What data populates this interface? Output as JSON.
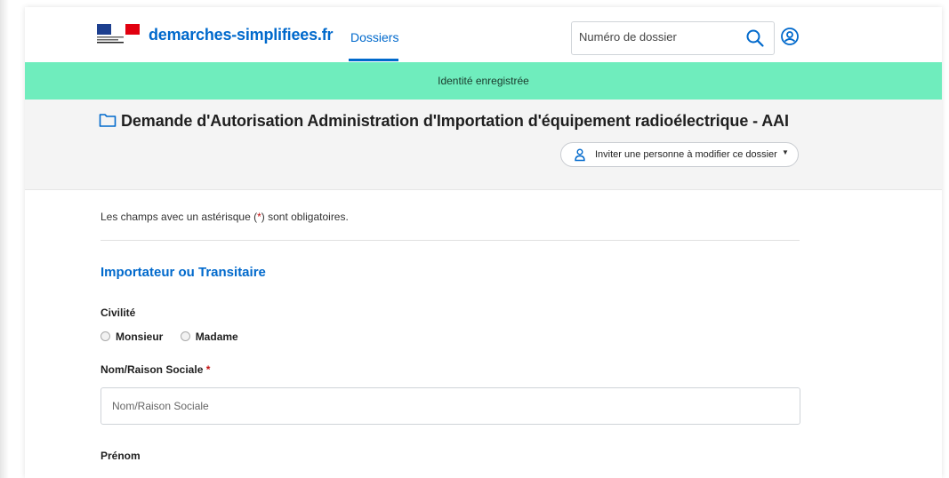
{
  "header": {
    "brand": "demarches-simplifiees.fr",
    "nav_tab": "Dossiers",
    "search": {
      "placeholder": "Numéro de dossier"
    }
  },
  "flash": {
    "message": "Identité enregistrée"
  },
  "dossier": {
    "title": "Demande d'Autorisation Administration d'Importation d'équipement radioélectrique - AAI",
    "invite_label": "Inviter une personne à modifier ce dossier"
  },
  "form": {
    "required_note_before": "Les champs avec un astérisque (",
    "required_star": "*",
    "required_note_after": ") sont obligatoires.",
    "section_title": "Importateur ou Transitaire",
    "civilite": {
      "label": "Civilité",
      "options": [
        "Monsieur",
        "Madame"
      ]
    },
    "nom": {
      "label": "Nom/Raison Sociale",
      "star": "*",
      "placeholder": "Nom/Raison Sociale"
    },
    "prenom": {
      "label": "Prénom"
    }
  },
  "colors": {
    "accent": "#0069cc",
    "flash": "#6fedbd",
    "required": "#c21111"
  }
}
